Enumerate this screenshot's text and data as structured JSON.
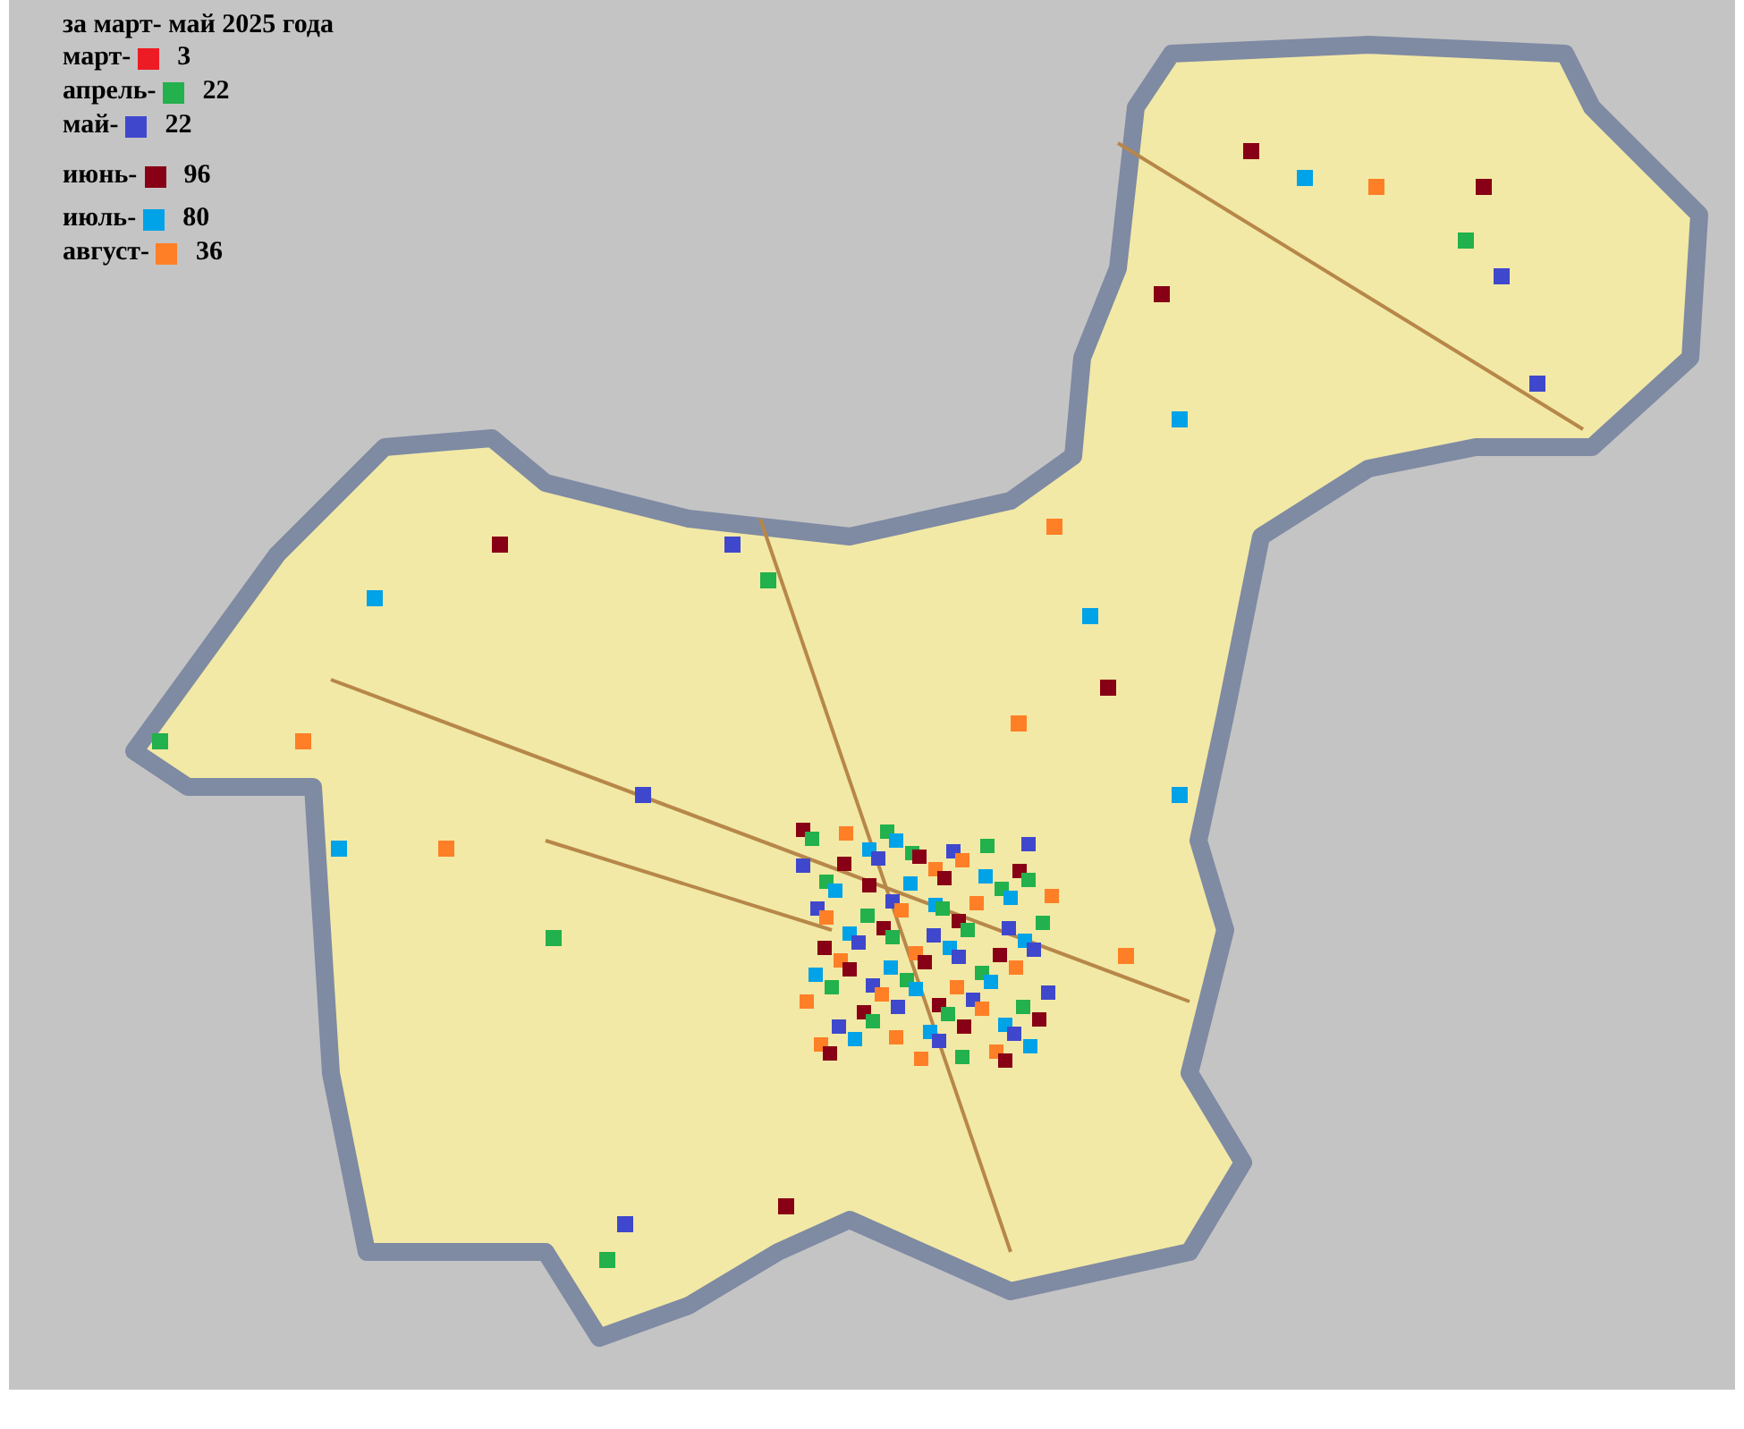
{
  "legend": {
    "subtitle": "за март- май 2025 года",
    "items": [
      {
        "label": "март-",
        "color": "#ed1c24",
        "count": "3"
      },
      {
        "label": "апрель-",
        "color": "#22b14c",
        "count": "22"
      },
      {
        "label": "май-",
        "color": "#3f48cc",
        "count": "22"
      },
      {
        "label": "июнь-",
        "color": "#880015",
        "count": "96"
      },
      {
        "label": "июль-",
        "color": "#00a2e8",
        "count": "80"
      },
      {
        "label": "август-",
        "color": "#ff7f27",
        "count": "36"
      }
    ]
  }
}
